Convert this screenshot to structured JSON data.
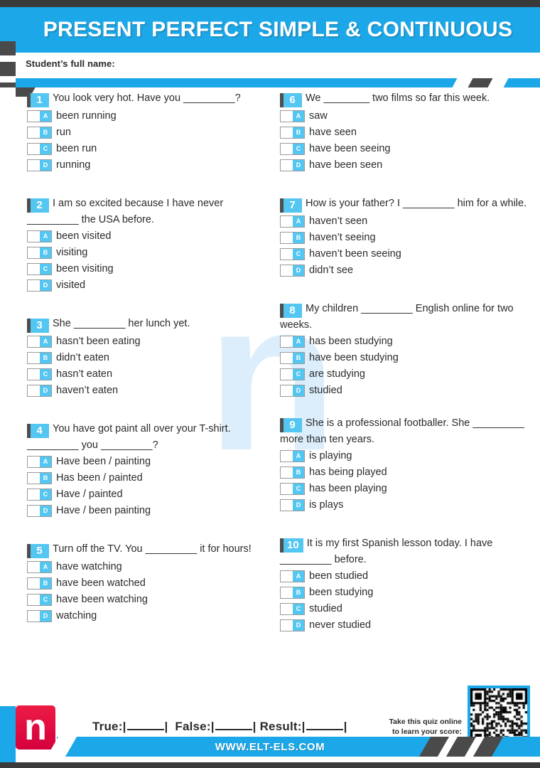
{
  "colors": {
    "brand_blue": "#1ba7e8",
    "light_blue": "#53c6f2",
    "dark_gray": "#4a4a4a",
    "logo_red": "#ec1c45",
    "watermark_blue": "#dceefb"
  },
  "header": {
    "title": "PRESENT PERFECT SIMPLE & CONTINUOUS",
    "name_label": "Student’s full name:"
  },
  "watermark": {
    "letter": "n"
  },
  "questions_left": [
    {
      "number": "1",
      "text": "You look very hot. Have you _________?",
      "options": [
        {
          "letter": "A",
          "text": "been running"
        },
        {
          "letter": "B",
          "text": "run"
        },
        {
          "letter": "C",
          "text": "been run"
        },
        {
          "letter": "D",
          "text": "running"
        }
      ]
    },
    {
      "number": "2",
      "text": "I am so excited because I have never _________ the USA before.",
      "options": [
        {
          "letter": "A",
          "text": "been visited"
        },
        {
          "letter": "B",
          "text": "visiting"
        },
        {
          "letter": "C",
          "text": "been visiting"
        },
        {
          "letter": "D",
          "text": "visited"
        }
      ]
    },
    {
      "number": "3",
      "text": "She _________ her lunch yet.",
      "options": [
        {
          "letter": "A",
          "text": "hasn’t been eating"
        },
        {
          "letter": "B",
          "text": "didn’t eaten"
        },
        {
          "letter": "C",
          "text": "hasn’t eaten"
        },
        {
          "letter": "D",
          "text": "haven’t eaten"
        }
      ]
    },
    {
      "number": "4",
      "text": "You have got paint all over your T-shirt. _________ you _________?",
      "options": [
        {
          "letter": "A",
          "text": "Have been / painting"
        },
        {
          "letter": "B",
          "text": "Has been / painted"
        },
        {
          "letter": "C",
          "text": "Have / painted"
        },
        {
          "letter": "D",
          "text": "Have / been painting"
        }
      ]
    },
    {
      "number": "5",
      "text": "Turn off the TV. You _________ it for hours!",
      "options": [
        {
          "letter": "A",
          "text": "have watching"
        },
        {
          "letter": "B",
          "text": "have been watched"
        },
        {
          "letter": "C",
          "text": "have been watching"
        },
        {
          "letter": "D",
          "text": "watching"
        }
      ]
    }
  ],
  "questions_right": [
    {
      "number": "6",
      "text": "We ________ two films so far this week.",
      "options": [
        {
          "letter": "A",
          "text": "saw"
        },
        {
          "letter": "B",
          "text": "have seen"
        },
        {
          "letter": "C",
          "text": "have been seeing"
        },
        {
          "letter": "D",
          "text": "have been seen"
        }
      ]
    },
    {
      "number": "7",
      "text": "How is your father? I _________ him for a while.",
      "options": [
        {
          "letter": "A",
          "text": "haven’t seen"
        },
        {
          "letter": "B",
          "text": "haven’t seeing"
        },
        {
          "letter": "C",
          "text": "haven’t been seeing"
        },
        {
          "letter": "D",
          "text": "didn’t see"
        }
      ]
    },
    {
      "number": "8",
      "text": "My children _________ English online for two weeks.",
      "options": [
        {
          "letter": "A",
          "text": "has been studying"
        },
        {
          "letter": "B",
          "text": "have been studying"
        },
        {
          "letter": "C",
          "text": "are studying"
        },
        {
          "letter": "D",
          "text": "studied"
        }
      ]
    },
    {
      "number": "9",
      "text": "She is a professional footballer. She _________ more than ten years.",
      "options": [
        {
          "letter": "A",
          "text": "is playing"
        },
        {
          "letter": "B",
          "text": "has being played"
        },
        {
          "letter": "C",
          "text": "has been playing"
        },
        {
          "letter": "D",
          "text": "is plays"
        }
      ]
    },
    {
      "number": "10",
      "text": "It is my first Spanish lesson today. I have _________ before.",
      "options": [
        {
          "letter": "A",
          "text": "been studied"
        },
        {
          "letter": "B",
          "text": "been studying"
        },
        {
          "letter": "C",
          "text": "studied"
        },
        {
          "letter": "D",
          "text": "never studied"
        }
      ]
    }
  ],
  "footer": {
    "logo_letter": "n",
    "true_label": "True:",
    "false_label": "False:",
    "result_label": "Result:",
    "qr_note_line1": "Take this quiz online",
    "qr_note_line2": "to learn your score:",
    "url": "WWW.ELT-ELS.COM"
  }
}
